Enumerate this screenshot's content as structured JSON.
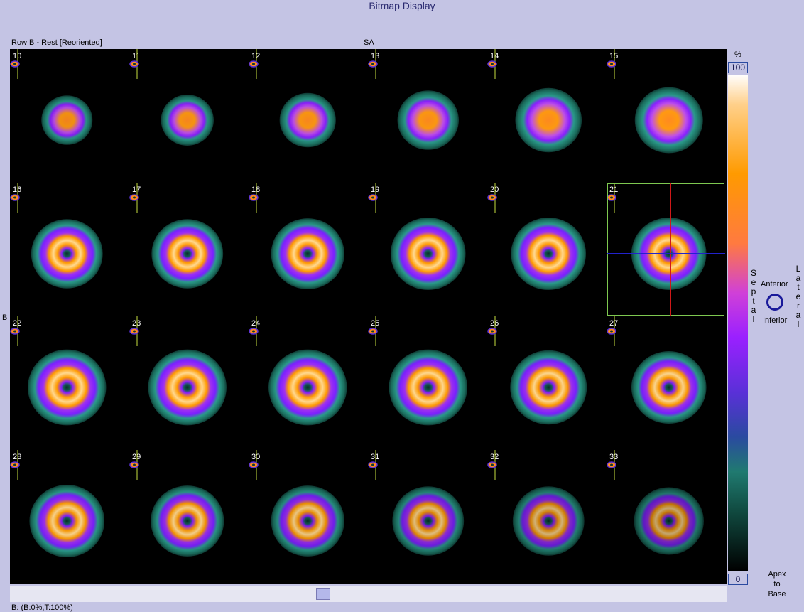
{
  "window": {
    "title": "Bitmap Display"
  },
  "header": {
    "row_label": "Row B - Rest [Reoriented]",
    "view_label": "SA"
  },
  "side_label": "B",
  "slices": [
    {
      "num": "10",
      "c": 0.2,
      "ring": 0.85,
      "s": 0.6
    },
    {
      "num": "11",
      "c": 0.3,
      "ring": 0.9,
      "s": 0.62
    },
    {
      "num": "12",
      "c": 0.4,
      "ring": 0.92,
      "s": 0.66
    },
    {
      "num": "13",
      "c": 0.55,
      "ring": 0.95,
      "s": 0.72
    },
    {
      "num": "14",
      "c": 0.45,
      "ring": 0.98,
      "s": 0.78
    },
    {
      "num": "15",
      "c": 0.2,
      "ring": 1.0,
      "s": 0.8
    },
    {
      "num": "16",
      "c": 0.1,
      "ring": 1.0,
      "s": 0.84
    },
    {
      "num": "17",
      "c": 0.05,
      "ring": 1.0,
      "s": 0.84
    },
    {
      "num": "18",
      "c": 0.0,
      "ring": 1.0,
      "s": 0.86
    },
    {
      "num": "19",
      "c": 0.0,
      "ring": 1.0,
      "s": 0.88
    },
    {
      "num": "20",
      "c": 0.0,
      "ring": 1.0,
      "s": 0.88
    },
    {
      "num": "21",
      "c": 0.0,
      "ring": 1.0,
      "s": 0.88
    },
    {
      "num": "22",
      "c": 0.0,
      "ring": 1.0,
      "s": 0.92
    },
    {
      "num": "23",
      "c": 0.0,
      "ring": 1.0,
      "s": 0.92
    },
    {
      "num": "24",
      "c": 0.0,
      "ring": 1.0,
      "s": 0.92
    },
    {
      "num": "25",
      "c": 0.0,
      "ring": 0.98,
      "s": 0.92
    },
    {
      "num": "26",
      "c": 0.0,
      "ring": 0.96,
      "s": 0.9
    },
    {
      "num": "27",
      "c": 0.0,
      "ring": 0.94,
      "s": 0.88
    },
    {
      "num": "28",
      "c": 0.0,
      "ring": 0.9,
      "s": 0.88
    },
    {
      "num": "29",
      "c": 0.0,
      "ring": 0.86,
      "s": 0.86
    },
    {
      "num": "30",
      "c": 0.0,
      "ring": 0.78,
      "s": 0.86
    },
    {
      "num": "31",
      "c": 0.0,
      "ring": 0.68,
      "s": 0.84
    },
    {
      "num": "32",
      "c": 0.0,
      "ring": 0.55,
      "s": 0.84
    },
    {
      "num": "33",
      "c": 0.0,
      "ring": 0.42,
      "s": 0.82
    }
  ],
  "selected_slice": "21",
  "colorbar": {
    "unit": "%",
    "max": "100",
    "min": "0"
  },
  "orientation": {
    "septal": "Septal",
    "lateral": "Lateral",
    "anterior": "Anterior",
    "inferior": "Inferior",
    "apex_line1": "Apex",
    "apex_line2": "to",
    "apex_line3": "Base"
  },
  "status": "B: (B:0%,T:100%)",
  "colors": {
    "background": "#c4c4e4",
    "grid_bg": "#000000",
    "selection": "#7ec850",
    "crosshair_v": "#d01818",
    "crosshair_h": "#2222cc"
  }
}
